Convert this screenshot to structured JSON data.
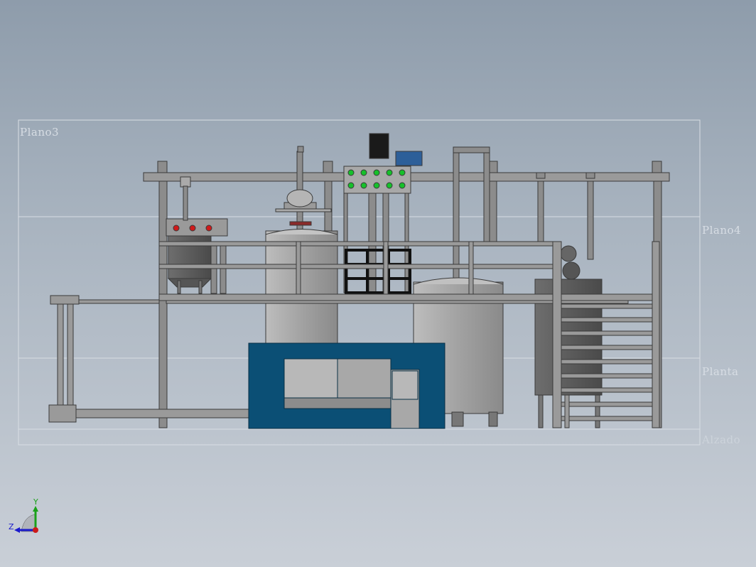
{
  "viewport": {
    "background_top": "#8e9cab",
    "background_bottom": "#c9cfd7"
  },
  "planes": {
    "top": "Plano3",
    "right": "Plano4",
    "middle": "Planta",
    "bottom": "Alzado"
  },
  "triad": {
    "y_axis": "Y",
    "z_axis": "Z",
    "y_color": "#1aa11a",
    "z_color": "#1a1acc",
    "x_color": "#cc1a1a"
  },
  "colors": {
    "frame": "#8c8c8c",
    "frame_edge": "#3a3a3a",
    "tank": "#a4a4a4",
    "blue_frame": "#0b4f75",
    "control_box": "#1a1a1a",
    "blue_box": "#2d5f99",
    "indicator_green": "#16c02a",
    "indicator_red": "#d01a1a"
  }
}
